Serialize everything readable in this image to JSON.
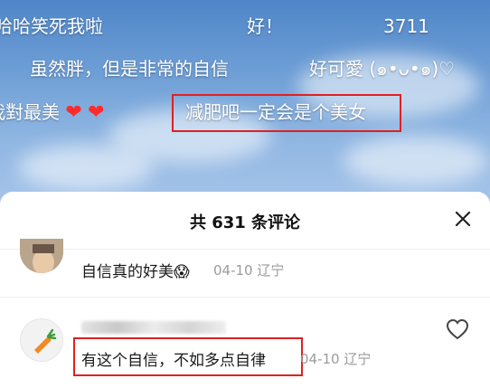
{
  "danmaku": [
    {
      "id": "d1",
      "text": "哈哈笑死我啦"
    },
    {
      "id": "d2",
      "text": "好！"
    },
    {
      "id": "d3",
      "text": "3711"
    },
    {
      "id": "d4",
      "text": "虽然胖，但是非常的自信"
    },
    {
      "id": "d5",
      "text": "好可愛 (๑•ᴗ•๑)♡"
    },
    {
      "id": "d6",
      "text": "我對最美"
    },
    {
      "id": "d7",
      "text": "减肥吧一定会是个美女"
    }
  ],
  "comments_panel": {
    "title": "共 631 条评论",
    "comments": [
      {
        "text": "自信真的好美",
        "emoji": "😱",
        "date": "04-10",
        "location": "辽宁"
      },
      {
        "text": "有这个自信，不如多点自律",
        "date": "04-10",
        "location": "辽宁"
      }
    ]
  },
  "icons": {
    "close": "close-icon",
    "like": "heart-outline-icon"
  },
  "colors": {
    "highlight": "#e02020",
    "heart": "#ff2b2b"
  }
}
